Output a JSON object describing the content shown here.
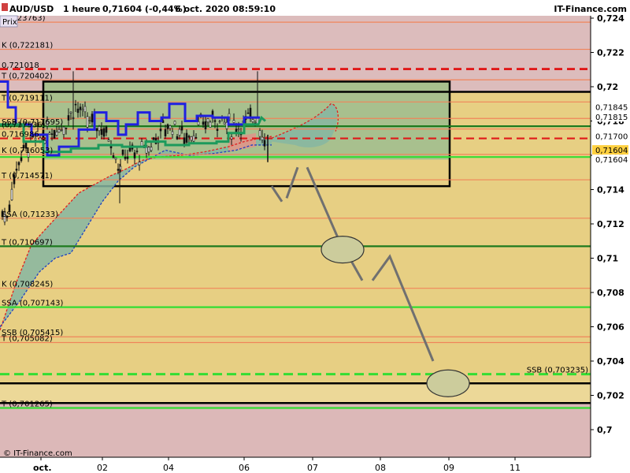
{
  "header": {
    "symbol": "AUD/USD",
    "period": "1 heure",
    "price_change": "0,71604 (-0,44%)",
    "datetime": "6 oct. 2020 08:59:10",
    "brand": "IT-Finance.com"
  },
  "footer": {
    "copyright": "© IT-Finance.com"
  },
  "prix_tab": "Prix",
  "colors": {
    "upper_zone": "#dcbcbc",
    "lower_zone": "#dcb8b8",
    "mid_zone": "#e7cf83",
    "box_fill": "#a8c08e",
    "kumo_green": "#86b6a2",
    "kumo_red": "#d89a8a",
    "level_orange": "#f0845a",
    "level_green": "#33dd33",
    "level_darkgreen": "#1e7a1e",
    "level_red_dash": "#e01818",
    "kijun_blue": "#2020e0",
    "tenkan_green": "#1c9a5c",
    "projection": "#707070"
  },
  "chart_data": {
    "type": "candlestick",
    "y_axis": {
      "range": [
        0.6988,
        0.7245
      ],
      "tick_values": [
        0.724,
        0.722,
        0.72,
        0.718,
        0.716,
        0.714,
        0.712,
        0.71,
        0.708,
        0.706,
        0.704,
        0.702,
        0.7
      ],
      "tick_labels": [
        "0,724",
        "0,722",
        "0,72",
        "0,718",
        "0,716",
        "0,714",
        "0,712",
        "0,71",
        "0,708",
        "0,706",
        "0,704",
        "0,702",
        "0,7"
      ],
      "bold_ticks": [
        "0,72",
        "0,71",
        "0,7"
      ]
    },
    "x_axis": {
      "tick_labels": [
        "oct.",
        "02",
        "04",
        "06",
        "07",
        "08",
        "09",
        "11"
      ],
      "bold_ticks": [
        "oct."
      ]
    },
    "levels": [
      {
        "label": "(0,723763)",
        "value": 0.723763,
        "style": "orange",
        "side": "left"
      },
      {
        "label": "K (0,722181)",
        "value": 0.722181,
        "style": "orange",
        "side": "left"
      },
      {
        "label": "0,721018",
        "value": 0.721018,
        "style": "red-dash",
        "side": "left"
      },
      {
        "label": "T (0,720402)",
        "value": 0.720402,
        "style": "orange",
        "side": "left"
      },
      {
        "label": "T (0,719111)",
        "value": 0.719111,
        "style": "orange",
        "side": "left"
      },
      {
        "label": "SSB (0,717695)",
        "value": 0.717695,
        "style": "darkgreen",
        "side": "left"
      },
      {
        "label": "(0,717536)",
        "value": 0.717536,
        "style": "orange",
        "side": "left"
      },
      {
        "label": "0,716986",
        "value": 0.716986,
        "style": "red-dash",
        "side": "left"
      },
      {
        "label": "K (0,716053)",
        "value": 0.716053,
        "style": "orange",
        "side": "left"
      },
      {
        "label": "T (0,714571)",
        "value": 0.714571,
        "style": "orange",
        "side": "left"
      },
      {
        "label": "SSA (0,71233)",
        "value": 0.71233,
        "style": "orange",
        "side": "left"
      },
      {
        "label": "T (0,710697)",
        "value": 0.710697,
        "style": "darkgreen",
        "side": "left"
      },
      {
        "label": "K (0,708245)",
        "value": 0.708245,
        "style": "orange",
        "side": "left"
      },
      {
        "label": "SSA (0,707143)",
        "value": 0.707143,
        "style": "green",
        "side": "left"
      },
      {
        "label": "SSB (0,705415)",
        "value": 0.705415,
        "style": "orange",
        "side": "left"
      },
      {
        "label": "T (0,705082)",
        "value": 0.705082,
        "style": "orange",
        "side": "left"
      },
      {
        "label": "SSB (0,703235)",
        "value": 0.703235,
        "style": "green-dash",
        "side": "right"
      },
      {
        "label": "T (0,701265)",
        "value": 0.701265,
        "style": "green",
        "side": "left"
      }
    ],
    "extra_lines": [
      {
        "value": 0.72105,
        "style": "red-dash"
      },
      {
        "value": 0.7197,
        "style": "black"
      },
      {
        "value": 0.7159,
        "style": "green"
      },
      {
        "value": 0.7027,
        "style": "black"
      },
      {
        "value": 0.70155,
        "style": "black"
      },
      {
        "value": 0.71815,
        "style": "orange"
      }
    ],
    "price_tags": [
      {
        "label": "0,71845",
        "value": 0.71845,
        "color": "#d04040",
        "bg": "#ffffff"
      },
      {
        "label": "0,71815",
        "value": 0.71815,
        "color": "#d04040",
        "bg": "#ffffff"
      },
      {
        "label": "0,71700",
        "value": 0.717,
        "color": "#000000",
        "bg": "#ffffff"
      },
      {
        "label": "0,71604",
        "value": 0.71604,
        "color": "#000000",
        "bg": "#ffd040"
      },
      {
        "label": "0,71604",
        "value": 0.71604,
        "color": "#000000",
        "bg": "#ffffff"
      }
    ]
  }
}
